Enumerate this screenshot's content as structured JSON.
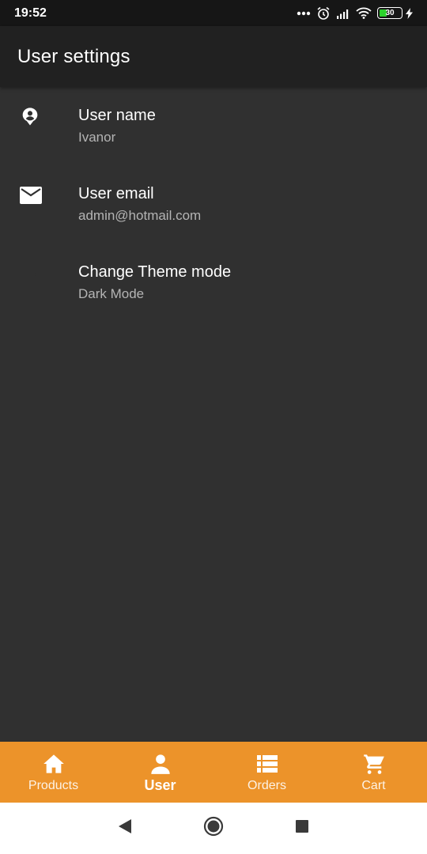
{
  "status_bar": {
    "time": "19:52",
    "battery_level": "30",
    "icons": [
      "more-dots-icon",
      "alarm-icon",
      "signal-icon",
      "wifi-icon",
      "battery-icon",
      "charging-icon"
    ]
  },
  "app_bar": {
    "title": "User settings"
  },
  "settings": {
    "items": [
      {
        "icon": "account-pin-icon",
        "title": "User name",
        "subtitle": "Ivanor"
      },
      {
        "icon": "mail-icon",
        "title": "User email",
        "subtitle": "admin@hotmail.com"
      },
      {
        "icon": "moon-icon",
        "title": "Change Theme mode",
        "subtitle": "Dark Mode"
      }
    ]
  },
  "bottom_nav": {
    "items": [
      {
        "icon": "home-icon",
        "label": "Products",
        "active": false
      },
      {
        "icon": "person-icon",
        "label": "User",
        "active": true
      },
      {
        "icon": "list-icon",
        "label": "Orders",
        "active": false
      },
      {
        "icon": "cart-icon",
        "label": "Cart",
        "active": false
      }
    ]
  },
  "system_nav": {
    "buttons": [
      "back-icon",
      "home-circle-icon",
      "recents-icon"
    ]
  },
  "colors": {
    "background": "#303030",
    "app_bar": "#212121",
    "status_bar": "#161616",
    "accent": "#ec932a",
    "subtitle_text": "#b4b4b4",
    "battery_green": "#2bd12b"
  }
}
